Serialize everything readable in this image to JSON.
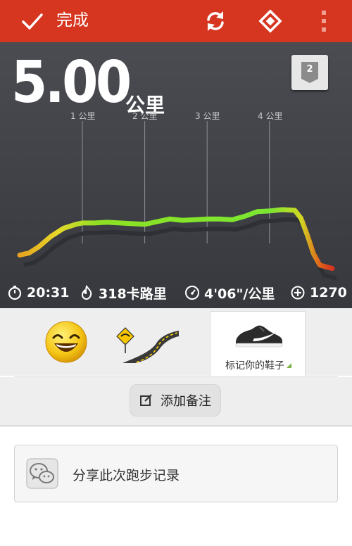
{
  "topbar": {
    "done_label": "完成",
    "icons": [
      "check-icon",
      "sync-icon",
      "diamond-icon",
      "more-icon"
    ],
    "color": "#d6351f"
  },
  "run": {
    "distance": "5.00",
    "distance_unit": "公里",
    "badge_number": "2",
    "km_markers": [
      "1 公里",
      "2 公里",
      "3 公里",
      "4 公里"
    ],
    "stats": {
      "duration": "20:31",
      "calories": "318卡路里",
      "pace": "4'06\"/公里",
      "fuel": "1270"
    }
  },
  "chart_data": {
    "type": "line",
    "x_unit": "公里",
    "x": [
      0.0,
      0.15,
      0.3,
      0.5,
      0.7,
      0.9,
      1.0,
      1.2,
      1.4,
      1.6,
      1.8,
      2.0,
      2.2,
      2.4,
      2.6,
      2.8,
      3.0,
      3.2,
      3.4,
      3.6,
      3.8,
      4.0,
      4.2,
      4.4,
      4.5,
      4.6,
      4.7,
      4.8,
      5.0
    ],
    "values": [
      0.3,
      0.33,
      0.42,
      0.58,
      0.7,
      0.76,
      0.78,
      0.78,
      0.79,
      0.78,
      0.77,
      0.76,
      0.8,
      0.84,
      0.82,
      0.83,
      0.84,
      0.84,
      0.83,
      0.88,
      0.95,
      0.96,
      0.98,
      0.97,
      0.85,
      0.6,
      0.32,
      0.15,
      0.1
    ],
    "value_note": "relative pace (higher is faster)",
    "colors": [
      "#e6a21f",
      "#e8d82a",
      "#8ee123",
      "#7be632",
      "#e0621c",
      "#d6351f"
    ]
  },
  "gear": {
    "shoe_label": "标记你的鞋子",
    "icons": [
      "smiley-face-icon",
      "road-terrain-icon",
      "running-shoe-icon"
    ]
  },
  "note": {
    "add_note_label": "添加备注"
  },
  "share": {
    "label": "分享此次跑步记录"
  }
}
